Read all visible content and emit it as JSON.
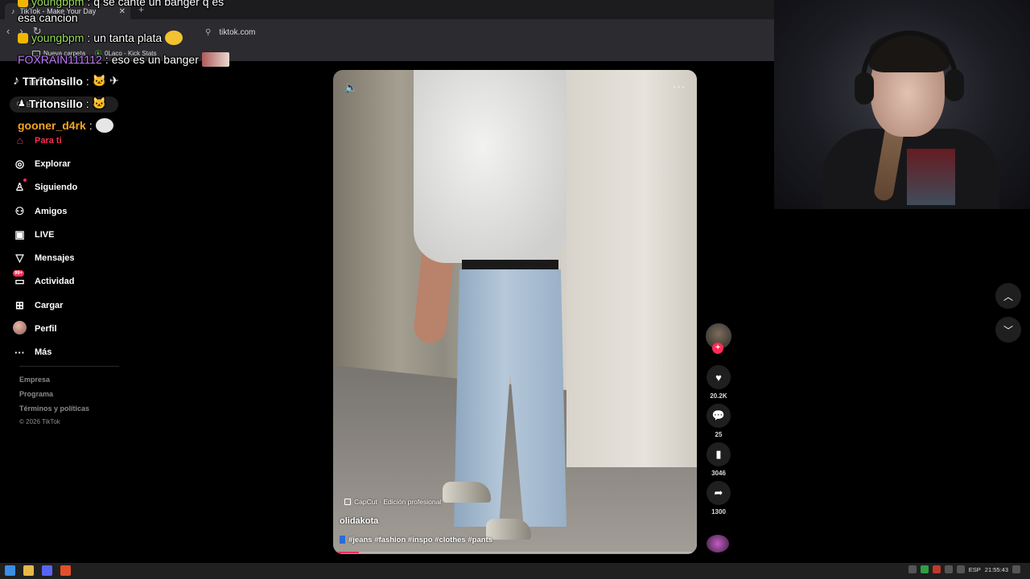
{
  "browser": {
    "tab_title": "TikTok - Make Your Day",
    "new_tab": "+",
    "url": "tiktok.com",
    "bookmarks": [
      {
        "label": "Nueva carpeta"
      },
      {
        "label": "0Laco - Kick Stats"
      }
    ]
  },
  "tiktok": {
    "logo": "TikTok",
    "search_placeholder": "Buscar",
    "nav": [
      {
        "label": "Para ti",
        "icon": "home-icon",
        "active": true
      },
      {
        "label": "Explorar",
        "icon": "compass-icon"
      },
      {
        "label": "Siguiendo",
        "icon": "following-icon"
      },
      {
        "label": "Amigos",
        "icon": "friends-icon"
      },
      {
        "label": "LIVE",
        "icon": "live-icon"
      },
      {
        "label": "Mensajes",
        "icon": "messages-icon"
      },
      {
        "label": "Actividad",
        "icon": "activity-icon",
        "badge": "99+"
      },
      {
        "label": "Cargar",
        "icon": "upload-icon"
      },
      {
        "label": "Perfil",
        "icon": "avatar"
      },
      {
        "label": "Más",
        "icon": "more-icon"
      }
    ],
    "footer": [
      "Empresa",
      "Programa",
      "Términos y políticas"
    ],
    "copyright": "© 2026 TikTok",
    "video": {
      "capcut": "CapCut · Edición profesional",
      "author": "olidakota",
      "hashtags": "#jeans #fashion #inspo #clothes #pants",
      "progress": 0.06
    },
    "actions": {
      "likes": "20.2K",
      "comments": "25",
      "saves": "3046",
      "shares": "1300"
    }
  },
  "chat": [
    {
      "user": "youngbpm",
      "msg": "q se cante un banger q es",
      "color": "#9be05b"
    },
    {
      "user": "",
      "msg": "esa cancion",
      "color": "#ffffff"
    },
    {
      "user": "youngbpm",
      "msg": "un tanta plata",
      "color": "#9be05b"
    },
    {
      "user": "FOXRAIN111112",
      "msg": "eso es un banger",
      "color": "#c07bff"
    },
    {
      "user": "Tritonsillo",
      "msg": "",
      "color": "#ffffff"
    },
    {
      "user": "Tritonsillo",
      "msg": "",
      "color": "#ffffff"
    },
    {
      "user": "gooner_d4rk",
      "msg": "",
      "color": "#f5a623"
    }
  ],
  "taskbar": {
    "lang": "ESP",
    "time": "21:55:43"
  },
  "colors": {
    "accent": "#fe2c55",
    "background": "#000000"
  }
}
